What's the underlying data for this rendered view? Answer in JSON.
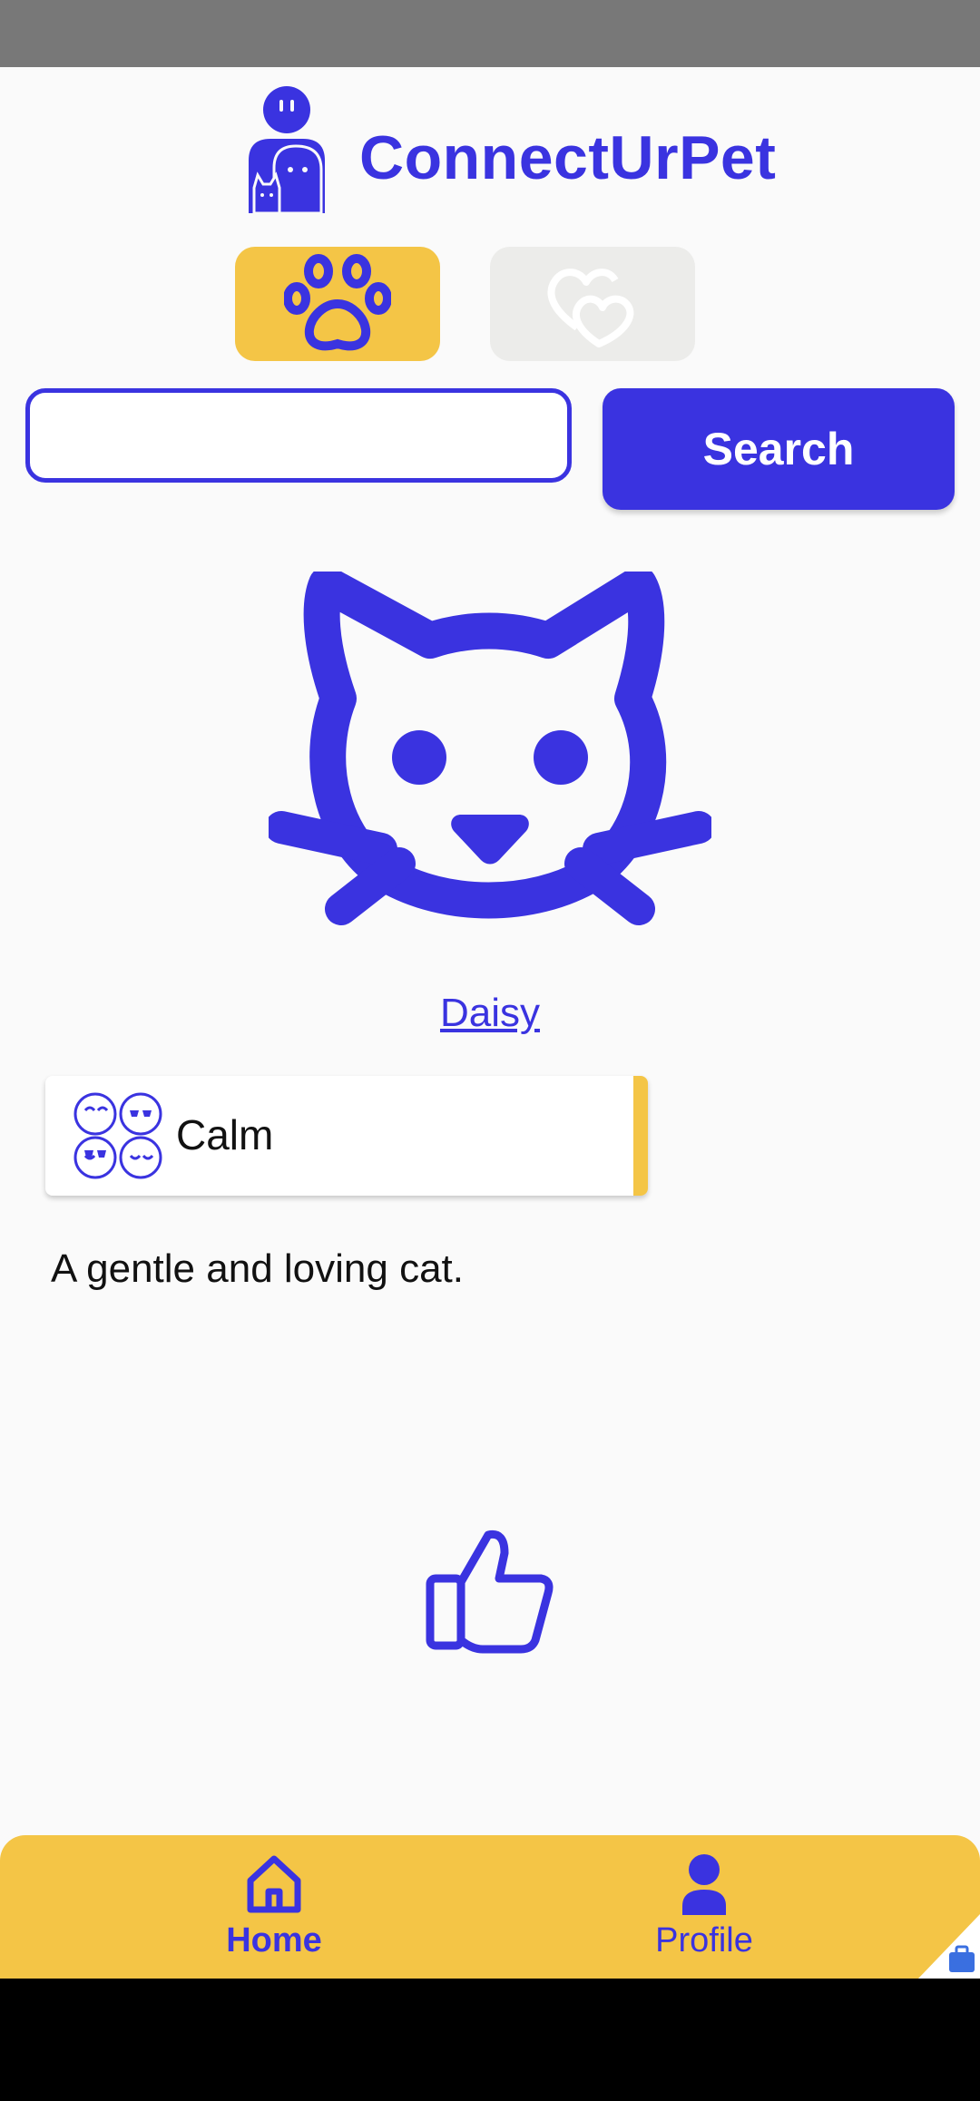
{
  "app": {
    "title": "ConnectUrPet"
  },
  "search": {
    "value": "",
    "button_label": "Search"
  },
  "pet": {
    "name": "Daisy",
    "trait": "Calm",
    "description": "A gentle and loving cat."
  },
  "bottom_nav": {
    "items": [
      {
        "label": "Home",
        "active": true
      },
      {
        "label": "Profile",
        "active": false
      }
    ]
  },
  "icons": {
    "logo": "person-with-pets-icon",
    "pets_tab": "paw-icon",
    "matches_tab": "hearts-icon",
    "pet_image": "cat-face-icon",
    "trait": "moods-icon",
    "like": "thumbs-up-icon",
    "home": "home-icon",
    "profile": "person-icon"
  },
  "colors": {
    "primary": "#3a33e0",
    "accent": "#f4c546",
    "background": "#fafafa",
    "inactive_tab": "#ececea"
  }
}
